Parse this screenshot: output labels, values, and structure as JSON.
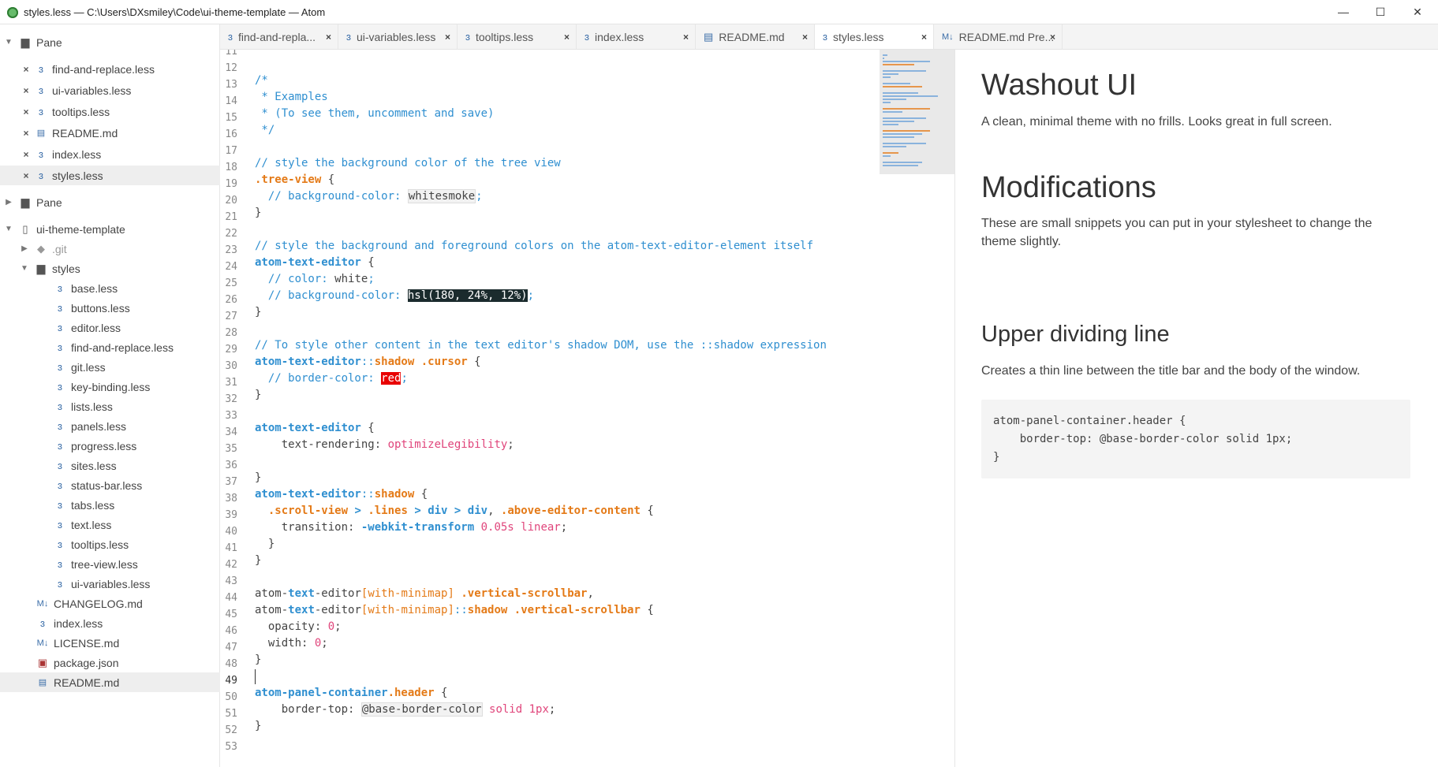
{
  "window": {
    "title": "styles.less — C:\\Users\\DXsmiley\\Code\\ui-theme-template — Atom",
    "minimize": "—",
    "maximize": "☐",
    "close": "✕"
  },
  "sidebar": {
    "pane1_label": "Pane",
    "open_files": [
      "find-and-replace.less",
      "ui-variables.less",
      "tooltips.less",
      "README.md",
      "index.less",
      "styles.less"
    ],
    "pane2_label": "Pane",
    "project_label": "ui-theme-template",
    "git_label": ".git",
    "styles_label": "styles",
    "styles_files": [
      "base.less",
      "buttons.less",
      "editor.less",
      "find-and-replace.less",
      "git.less",
      "key-binding.less",
      "lists.less",
      "panels.less",
      "progress.less",
      "sites.less",
      "status-bar.less",
      "tabs.less",
      "text.less",
      "tooltips.less",
      "tree-view.less",
      "ui-variables.less"
    ],
    "root_files": [
      "CHANGELOG.md",
      "index.less",
      "LICENSE.md",
      "package.json",
      "README.md"
    ]
  },
  "tabs": [
    {
      "label": "find-and-repla...",
      "icon": "less-file-icon"
    },
    {
      "label": "ui-variables.less",
      "icon": "less-file-icon"
    },
    {
      "label": "tooltips.less",
      "icon": "less-file-icon"
    },
    {
      "label": "index.less",
      "icon": "less-file-icon"
    },
    {
      "label": "README.md",
      "icon": "book-icon"
    },
    {
      "label": "styles.less",
      "icon": "less-file-icon"
    },
    {
      "label": "README.md Pre...",
      "icon": "markdown-icon"
    }
  ],
  "editor": {
    "line_numbers": [
      "11",
      "12",
      "13",
      "14",
      "15",
      "16",
      "17",
      "18",
      "19",
      "20",
      "21",
      "22",
      "23",
      "24",
      "25",
      "26",
      "27",
      "28",
      "29",
      "30",
      "31",
      "32",
      "33",
      "34",
      "35",
      "36",
      "37",
      "38",
      "39",
      "40",
      "41",
      "42",
      "43",
      "44",
      "45",
      "46",
      "47",
      "48",
      "49",
      "50",
      "51",
      "52",
      "53"
    ],
    "cursor_line": "49"
  },
  "preview": {
    "h1": "Washout UI",
    "intro": "A clean, minimal theme with no frills. Looks great in full screen.",
    "h2": "Modifications",
    "mods_text": "These are small snippets you can put in your stylesheet to change the theme slightly.",
    "h3": "Upper dividing line",
    "divider_text": "Creates a thin line between the title bar and the body of the window.",
    "code_block": "atom-panel-container.header {\n    border-top: @base-border-color solid 1px;\n}"
  },
  "colors": {
    "comment_blue": "#2f8fd0",
    "selector_orange": "#e47a17",
    "number_pink": "#e0457b",
    "highlight_dark": "#1b2b2d",
    "highlight_red": "#e80000"
  }
}
